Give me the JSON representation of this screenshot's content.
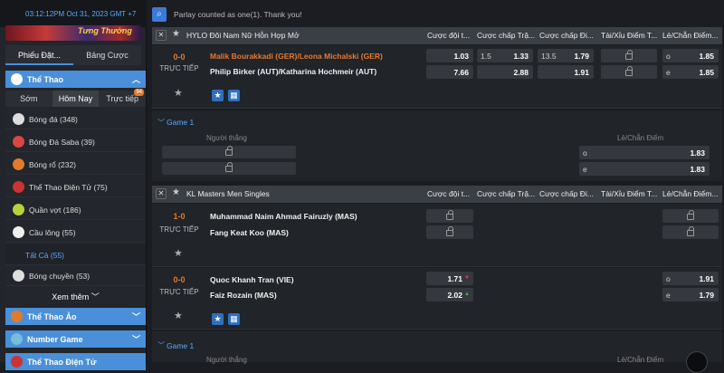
{
  "sidebar": {
    "clock": "03:12:12PM Oct 31, 2023 GMT +7",
    "banner_text": "Tưng Thưởng",
    "tabs": [
      "Phiếu Đặt...",
      "Bảng Cược"
    ],
    "section_sports": "Thể Thao",
    "day_tabs": [
      "Sớm",
      "Hôm Nay",
      "Trực tiếp"
    ],
    "live_badge": "94",
    "sports": [
      {
        "label": "Bóng đá",
        "count": "(348)",
        "color": "#ddd"
      },
      {
        "label": "Bóng Đá Saba",
        "count": "(39)",
        "color": "#d44"
      },
      {
        "label": "Bóng rổ",
        "count": "(232)",
        "color": "#e07b2b"
      },
      {
        "label": "Thể Thao Điện Tử",
        "count": "(75)",
        "color": "#c33"
      },
      {
        "label": "Quần vợt",
        "count": "(186)",
        "color": "#b9d23a"
      },
      {
        "label": "Cầu lông",
        "count": "(55)",
        "color": "#eee"
      }
    ],
    "all_label": "Tất Cả",
    "all_count": "(55)",
    "volleyball": {
      "label": "Bóng chuyền",
      "count": "(53)"
    },
    "see_more": "Xem thêm",
    "section_virtual": "Thể Thao Ảo",
    "section_number": "Number Game",
    "section_esports": "Thể Thao Điện Tử"
  },
  "topbar": {
    "message": "Parlay counted as one(1). Thank you!"
  },
  "columns": [
    "Cược đội t...",
    "Cược chấp Trậ...",
    "Cược chấp Đi...",
    "Tài/Xỉu Điểm T...",
    "Lẻ/Chẵn Điểm..."
  ],
  "columns2": [
    "Cược đội t...",
    "Cược chấp Trậ...",
    "Cược chấp Đi...",
    "Tài/Xỉu Điểm T...",
    "Lẻ/Chẵn Điểm..."
  ],
  "league1": {
    "name": "HYLO Đôi Nam Nữ Hỗn Hợp Mở",
    "match": {
      "score": "0-0",
      "status": "TRỰC TIẾP",
      "team1": "Malik Bourakkadi (GER)/Leona Michalski (GER)",
      "team2": "Philip Birker (AUT)/Katharina Hochmeir (AUT)",
      "ml1": "1.03",
      "ml2": "7.66",
      "hcp_h": "1.5",
      "hcp1": "1.33",
      "hcp2": "2.88",
      "pts_h": "13.5",
      "pts1": "1.79",
      "pts2": "1.91",
      "oe1_h": "o",
      "oe1": "1.85",
      "oe2_h": "e",
      "oe2": "1.85"
    },
    "game": {
      "label": "Game 1",
      "winner_label": "Người thắng",
      "oe_label": "Lẻ/Chẵn Điểm",
      "o_h": "o",
      "o": "1.83",
      "e_h": "e",
      "e": "1.83"
    }
  },
  "league2": {
    "name": "KL Masters Men Singles",
    "match1": {
      "score": "1-0",
      "status": "TRỰC TIẾP",
      "team1": "Muhammad Naim Ahmad Fairuzly (MAS)",
      "team2": "Fang Keat Koo (MAS)"
    },
    "match2": {
      "score": "0-0",
      "status": "TRỰC TIẾP",
      "team1": "Quoc Khanh Tran (VIE)",
      "team2": "Faiz Rozain (MAS)",
      "ml1": "1.71",
      "ml2": "2.02",
      "oe1_h": "o",
      "oe1": "1.91",
      "oe2_h": "e",
      "oe2": "1.79"
    },
    "game": {
      "label": "Game 1",
      "winner_label": "Người thắng",
      "oe_label": "Lẻ/Chẵn Điểm"
    }
  }
}
